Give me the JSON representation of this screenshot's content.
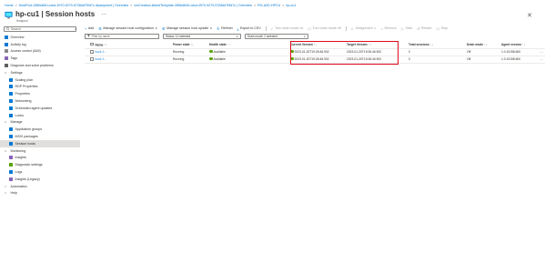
{
  "breadcrumb": [
    "Home",
    "HostPool-285bd840-cdcd-4970-9279-5728dd7f9d7c deployment | Overview",
    "vmCreation-linkedTemplate-285bd840-cdcd-4970-9279-5728dd7f9d7c | Overview",
    "RG-AVD-HPCU",
    "hp-cu1"
  ],
  "page": {
    "title": "hp-cu1 | Session hosts",
    "subtitle": "Hostpool",
    "more": "…",
    "close": "✕"
  },
  "sidebar": {
    "search_placeholder": "Search",
    "collapse": "«",
    "items": [
      {
        "label": "Overview",
        "icon": "overview-icon",
        "color": "#0078d4",
        "level": 0
      },
      {
        "label": "Activity log",
        "icon": "activity-log-icon",
        "color": "#0078d4",
        "level": 0
      },
      {
        "label": "Access control (IAM)",
        "icon": "iam-icon",
        "color": "#8a8886",
        "level": 0
      },
      {
        "label": "Tags",
        "icon": "tag-icon",
        "color": "#8764b8",
        "level": 0
      },
      {
        "label": "Diagnose and solve problems",
        "icon": "diagnose-icon",
        "color": "#605e5c",
        "level": 0
      },
      {
        "label": "Settings",
        "icon": "chevron",
        "color": "",
        "level": 0,
        "chevron": "∨"
      },
      {
        "label": "Scaling plan",
        "icon": "scaling-plan-icon",
        "color": "#0078d4",
        "level": 1
      },
      {
        "label": "RDP Properties",
        "icon": "rdp-properties-icon",
        "color": "#0078d4",
        "level": 1
      },
      {
        "label": "Properties",
        "icon": "properties-icon",
        "color": "#0078d4",
        "level": 1
      },
      {
        "label": "Networking",
        "icon": "networking-icon",
        "color": "#0078d4",
        "level": 1
      },
      {
        "label": "Scheduled agent updates",
        "icon": "clock-icon",
        "color": "#0078d4",
        "level": 1
      },
      {
        "label": "Locks",
        "icon": "lock-icon",
        "color": "#0078d4",
        "level": 1
      },
      {
        "label": "Manage",
        "icon": "chevron",
        "color": "",
        "level": 0,
        "chevron": "∨"
      },
      {
        "label": "Application groups",
        "icon": "app-groups-icon",
        "color": "#0078d4",
        "level": 1
      },
      {
        "label": "MSIX packages",
        "icon": "msix-icon",
        "color": "#0078d4",
        "level": 1
      },
      {
        "label": "Session hosts",
        "icon": "session-hosts-icon",
        "color": "#0078d4",
        "level": 1,
        "active": true
      },
      {
        "label": "Monitoring",
        "icon": "chevron",
        "color": "",
        "level": 0,
        "chevron": "∨"
      },
      {
        "label": "Insights",
        "icon": "insights-icon",
        "color": "#8764b8",
        "level": 1
      },
      {
        "label": "Diagnostic settings",
        "icon": "diagnostic-settings-icon",
        "color": "#57a300",
        "level": 1
      },
      {
        "label": "Logs",
        "icon": "logs-icon",
        "color": "#0078d4",
        "level": 1
      },
      {
        "label": "Insights (Legacy)",
        "icon": "insights-legacy-icon",
        "color": "#8764b8",
        "level": 1
      },
      {
        "label": "Automation",
        "icon": "chevron",
        "color": "",
        "level": 0,
        "chevron": ">"
      },
      {
        "label": "Help",
        "icon": "chevron",
        "color": "",
        "level": 0,
        "chevron": ">"
      }
    ]
  },
  "toolbar": {
    "items": [
      {
        "label": "Add",
        "glyph": "+",
        "name": "add-button",
        "disabled": false
      },
      {
        "label": "Manage session host configuration",
        "glyph": "⚙",
        "name": "manage-config-button",
        "disabled": false,
        "caret": true
      },
      {
        "label": "Manage session host update",
        "glyph": "⚙",
        "name": "manage-update-button",
        "disabled": false,
        "caret": true
      },
      {
        "label": "Refresh",
        "glyph": "↻",
        "name": "refresh-button",
        "disabled": false
      },
      {
        "label": "Export to CSV",
        "glyph": "⤓",
        "name": "export-csv-button",
        "disabled": false
      },
      {
        "label": "Turn drain mode on",
        "glyph": "✓",
        "name": "drain-on-button",
        "disabled": true
      },
      {
        "label": "Turn drain mode off",
        "glyph": "☐",
        "name": "drain-off-button",
        "disabled": true
      },
      {
        "label": "Assignment",
        "glyph": "☺",
        "name": "assignment-button",
        "disabled": true,
        "caret": true
      },
      {
        "label": "Remove",
        "glyph": "⌂",
        "name": "remove-button",
        "disabled": true
      },
      {
        "label": "Start",
        "glyph": "▷",
        "name": "start-button",
        "disabled": true
      },
      {
        "label": "Restart",
        "glyph": "↺",
        "name": "restart-button",
        "disabled": true
      },
      {
        "label": "Stop",
        "glyph": "☐",
        "name": "stop-button",
        "disabled": true
      }
    ]
  },
  "filters": {
    "search_placeholder": "Filter by name",
    "status": "Status: 12 selected",
    "drain": "Drain mode: 2 selected",
    "caret": "∨"
  },
  "table": {
    "columns": [
      "Name",
      "Power state",
      "Health state",
      "Current Version",
      "Target Version",
      "Total sessions",
      "Drain mode",
      "Agent version"
    ],
    "sortable": [
      true,
      true,
      true,
      true,
      true,
      true,
      true,
      true
    ],
    "sort_glyph": "↑↓",
    "rows": [
      {
        "name": "hcu1-f...",
        "power": "Running",
        "health": "Available",
        "current": "2023-01-20T19:26:46.902",
        "target": "2023-01-20T19:26:46.902",
        "sessions": "0",
        "drain": "Off",
        "agent": "1.0.10158.600"
      },
      {
        "name": "hcu1-f...",
        "power": "Running",
        "health": "Available",
        "current": "2023-01-20T19:26:46.902",
        "target": "2023-01-20T19:26:46.902",
        "sessions": "0",
        "drain": "Off",
        "agent": "1.0.10158.600"
      }
    ],
    "more": "···"
  },
  "colors": {
    "accent": "#0078d4",
    "highlight": "#e00b1c",
    "healthy": "#57a300"
  }
}
